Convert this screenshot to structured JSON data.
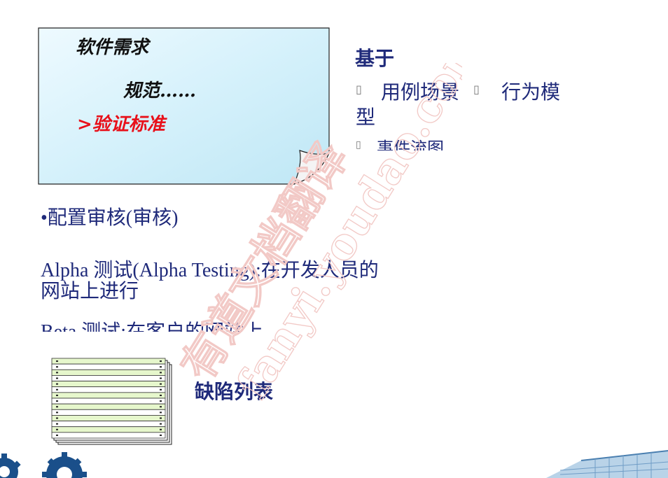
{
  "note": {
    "line1": "软件需求",
    "line2": "规范……",
    "line3": ">验证标准"
  },
  "right": {
    "heading": "基于",
    "item1_line1": "用例场景",
    "item1_after": "行为模",
    "item1_line2": "型",
    "item2": "事件流图"
  },
  "main": {
    "audit": "•配置审核(审核)",
    "alpha_line1": "Alpha 测试(Alpha  Testing):在开发人员的",
    "alpha_line2": "网站上进行",
    "beta": "Beta 测试:在客户的网站上"
  },
  "defect_list": {
    "label": "缺陷列表"
  },
  "watermark": {
    "text1": "有道文档翻译",
    "text2": "fanyi.youdao.com"
  },
  "colors": {
    "text_blue": "#1f2a7a",
    "red": "#e8101a",
    "note_fill": "#cfeef9",
    "defect_row": "#e6f7cc"
  }
}
